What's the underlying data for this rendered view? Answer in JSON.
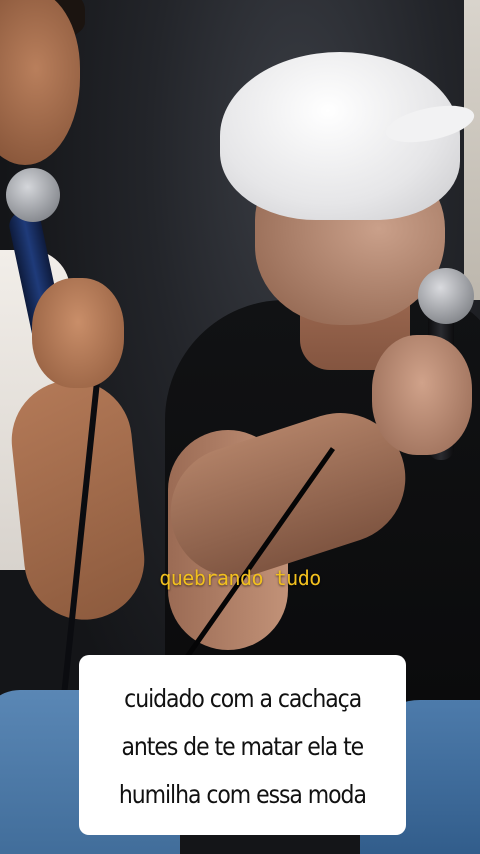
{
  "video": {
    "overlay_label": "quebrando tudo",
    "caption_lines": [
      "cuidado com a cachaça",
      "antes de te matar ela te",
      "humilha com essa moda"
    ]
  },
  "colors": {
    "overlay_label": "#f2c01e",
    "caption_background": "#ffffff",
    "caption_text": "#111111"
  },
  "scene": {
    "description_icons": [
      "microphone-icon",
      "microphone-icon"
    ]
  }
}
